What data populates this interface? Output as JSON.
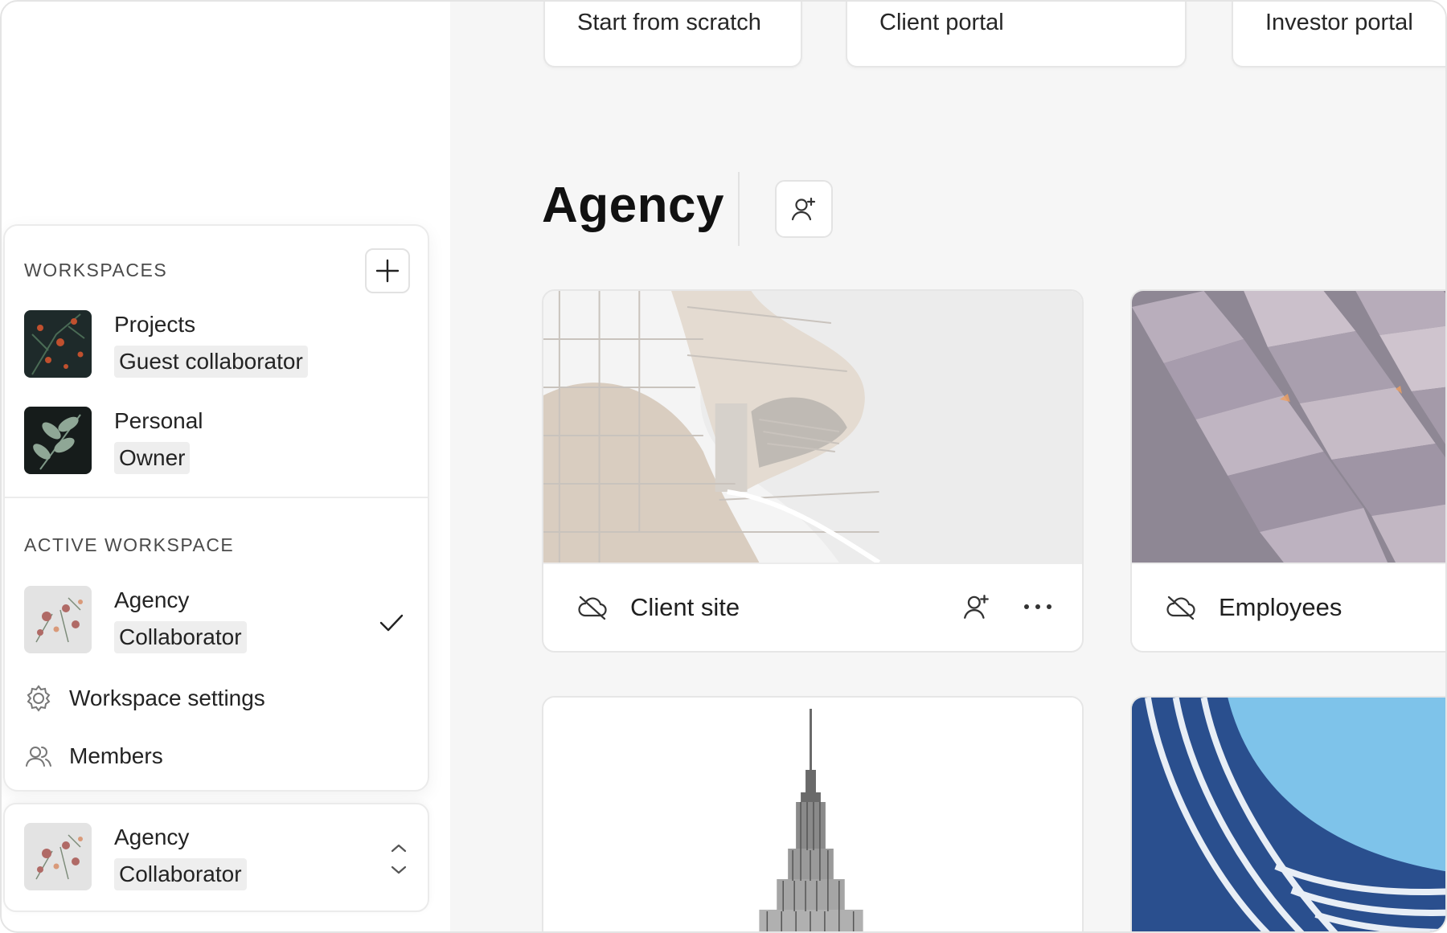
{
  "templates": [
    "Start from scratch",
    "Client portal",
    "Investor portal"
  ],
  "workspace": {
    "title": "Agency"
  },
  "cards": [
    {
      "name": "Client site"
    },
    {
      "name": "Employees"
    }
  ],
  "sidebar": {
    "workspaces_label": "WORKSPACES",
    "workspaces": [
      {
        "name": "Projects",
        "role": "Guest collaborator",
        "thumb": "dark-floral"
      },
      {
        "name": "Personal",
        "role": "Owner",
        "thumb": "dark-leaves"
      }
    ],
    "active_label": "ACTIVE WORKSPACE",
    "active": {
      "name": "Agency",
      "role": "Collaborator",
      "thumb": "light-floral",
      "selected": true
    },
    "menu": [
      {
        "label": "Workspace settings",
        "icon": "gear-icon"
      },
      {
        "label": "Members",
        "icon": "members-icon"
      }
    ],
    "switcher": {
      "name": "Agency",
      "role": "Collaborator"
    }
  },
  "colors": {
    "background": "#f6f6f6",
    "surface": "#ffffff",
    "border": "#e6e6e6",
    "role_badge": "#eeeeee"
  }
}
